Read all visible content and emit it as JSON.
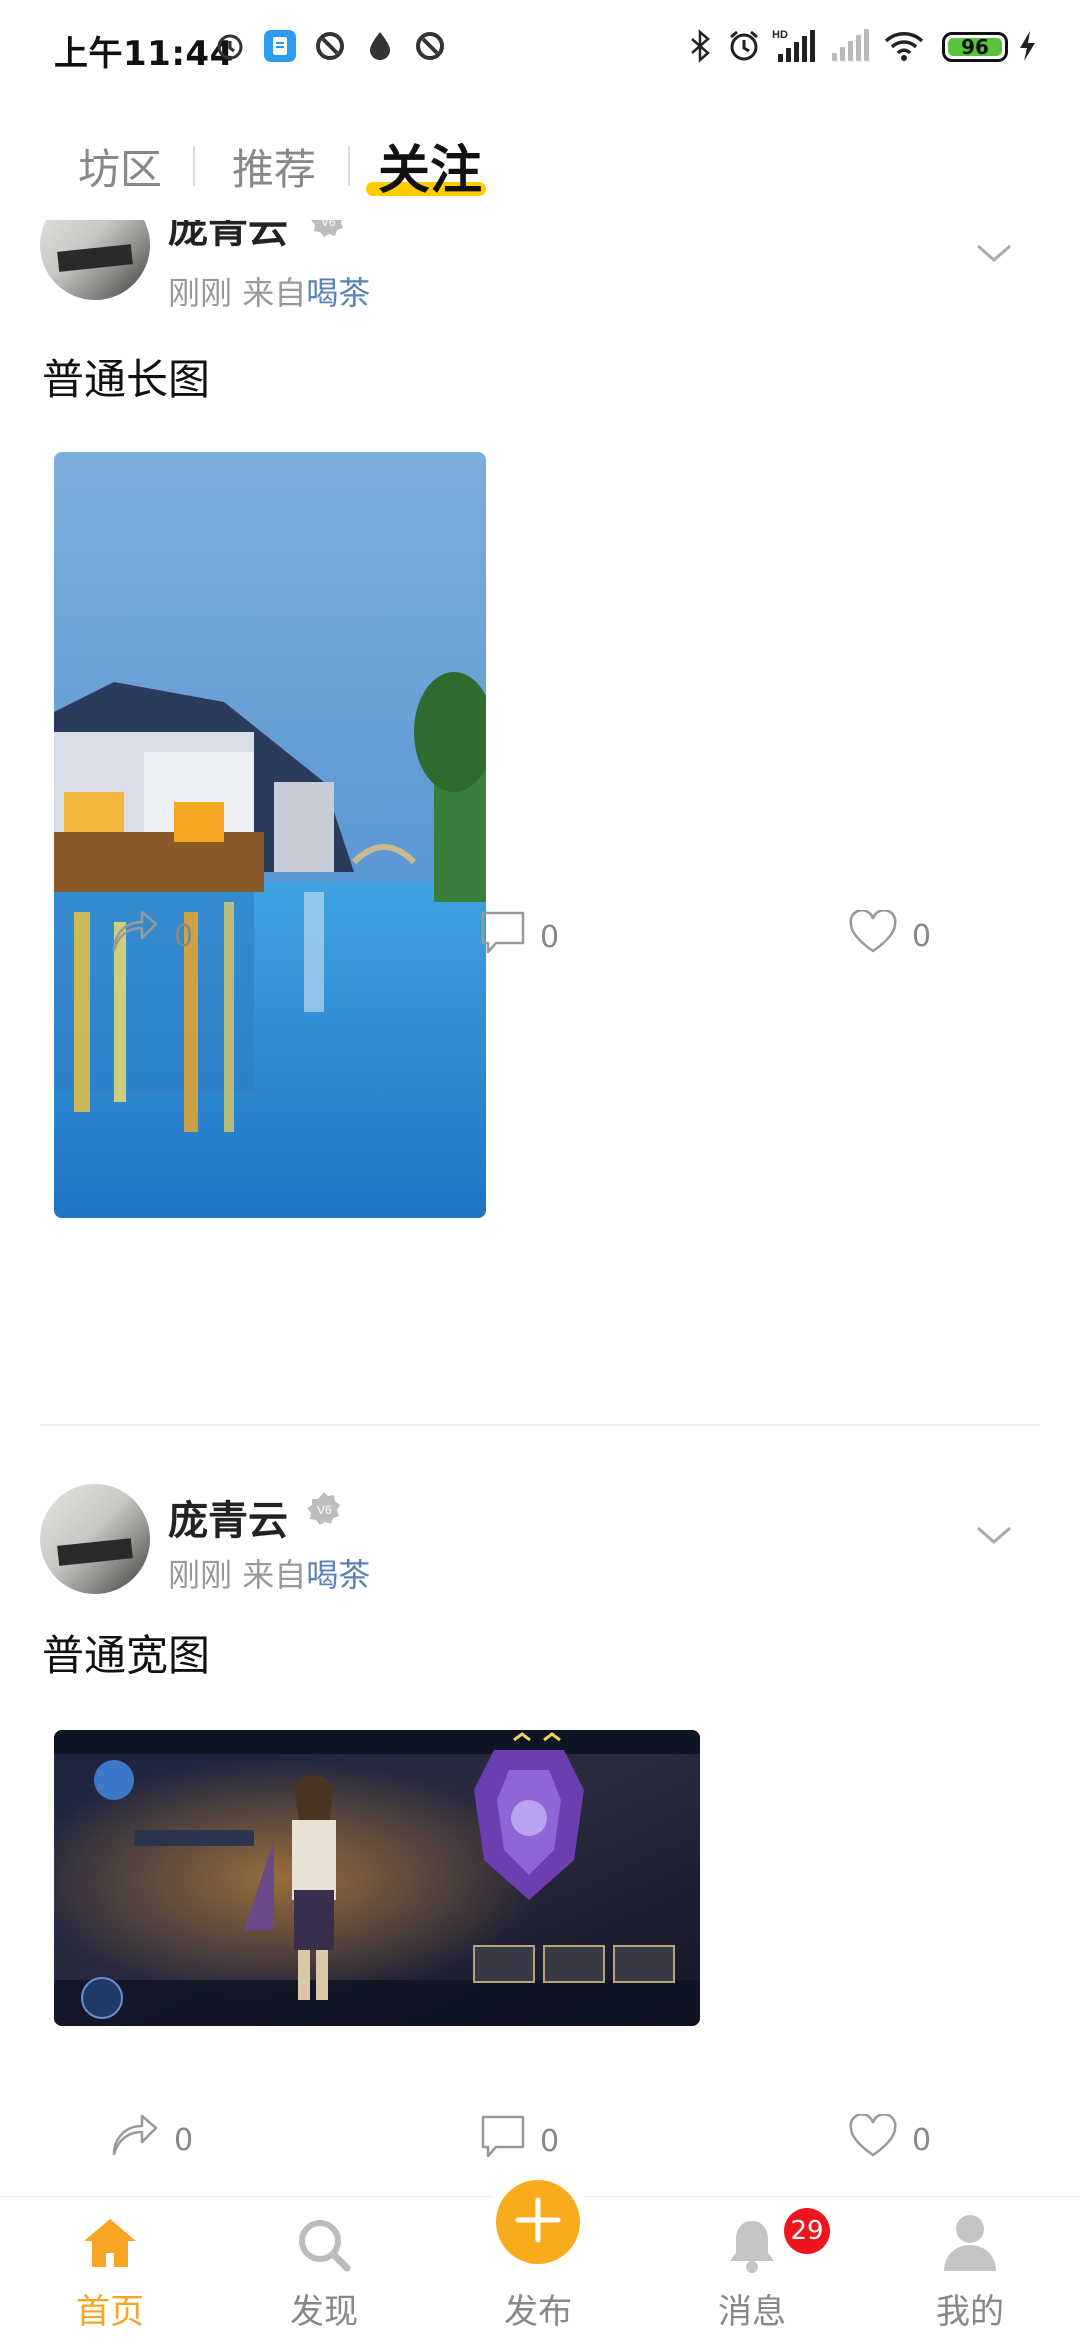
{
  "status_bar": {
    "time": "上午11:44",
    "battery_level": "96",
    "left_icons": [
      "alarm-icon",
      "notes-app-icon",
      "circle-slash-icon",
      "droplet-icon",
      "circle-slash-icon"
    ],
    "right_icons": [
      "bluetooth-icon",
      "alarm-icon",
      "hd-signal-icon",
      "signal-icon",
      "wifi-icon",
      "battery-icon",
      "charging-icon"
    ]
  },
  "tabs": [
    {
      "label": "坊区",
      "active": false
    },
    {
      "label": "推荐",
      "active": false
    },
    {
      "label": "关注",
      "active": true
    }
  ],
  "posts": [
    {
      "username": "庞青云",
      "time": "刚刚",
      "from_prefix": "来自",
      "source": "喝茶",
      "title": "普通长图",
      "image": "canal-town-night-photo",
      "shares": "0",
      "comments": "0",
      "likes": "0"
    },
    {
      "username": "庞青云",
      "time": "刚刚",
      "from_prefix": "来自",
      "source": "喝茶",
      "title": "普通宽图",
      "image": "game-character-screenshot",
      "shares": "0",
      "comments": "0",
      "likes": "0"
    }
  ],
  "bottom_nav": [
    {
      "label": "首页",
      "icon": "home-icon",
      "active": true
    },
    {
      "label": "发现",
      "icon": "search-icon",
      "active": false
    },
    {
      "label": "发布",
      "icon": "plus-icon",
      "active": false
    },
    {
      "label": "消息",
      "icon": "bell-icon",
      "active": false,
      "badge": "29"
    },
    {
      "label": "我的",
      "icon": "user-icon",
      "active": false
    }
  ],
  "colors": {
    "accent": "#f8ac1b",
    "tab_underline": "#ffcc00",
    "source_link": "#5b82b7",
    "badge": "#f0141e"
  }
}
